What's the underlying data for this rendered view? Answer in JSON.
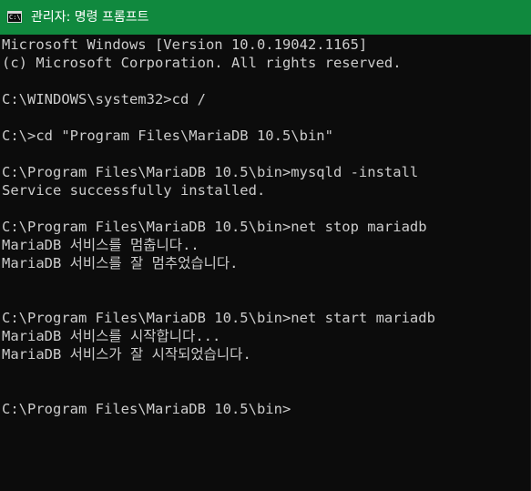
{
  "window": {
    "title": "관리자: 명령 프롬프트",
    "icon": "cmd-icon",
    "icon_glyph": "C:\\",
    "titlebar_color": "#10893e"
  },
  "console": {
    "text_color": "#cccccc",
    "background": "#0c0c0c",
    "lines": [
      "Microsoft Windows [Version 10.0.19042.1165]",
      "(c) Microsoft Corporation. All rights reserved.",
      "",
      "C:\\WINDOWS\\system32>cd /",
      "",
      "C:\\>cd \"Program Files\\MariaDB 10.5\\bin\"",
      "",
      "C:\\Program Files\\MariaDB 10.5\\bin>mysqld -install",
      "Service successfully installed.",
      "",
      "C:\\Program Files\\MariaDB 10.5\\bin>net stop mariadb",
      "MariaDB 서비스를 멈춥니다..",
      "MariaDB 서비스를 잘 멈추었습니다.",
      "",
      "",
      "C:\\Program Files\\MariaDB 10.5\\bin>net start mariadb",
      "MariaDB 서비스를 시작합니다...",
      "MariaDB 서비스가 잘 시작되었습니다.",
      "",
      "",
      "C:\\Program Files\\MariaDB 10.5\\bin>"
    ]
  }
}
